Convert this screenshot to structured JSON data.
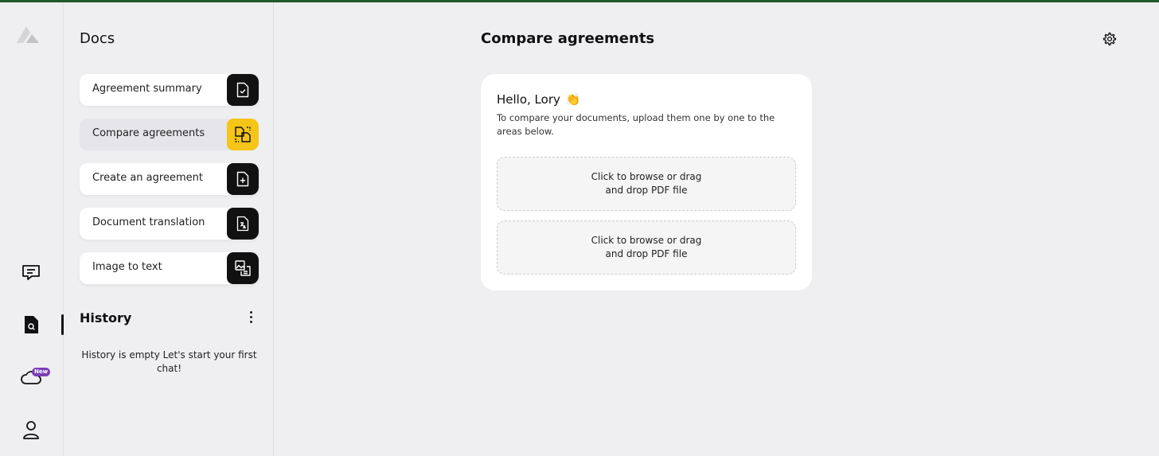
{
  "rail": {
    "items": [
      {
        "name": "chat",
        "icon": "chat-bubble-icon"
      },
      {
        "name": "docs",
        "icon": "document-search-icon"
      },
      {
        "name": "cloud",
        "icon": "cloud-icon",
        "badge": "New"
      },
      {
        "name": "profile",
        "icon": "user-icon"
      }
    ],
    "active": "docs"
  },
  "docs": {
    "title": "Docs",
    "items": [
      {
        "label": "Agreement summary",
        "icon": "document-check-icon"
      },
      {
        "label": "Compare agreements",
        "icon": "document-compare-icon",
        "active": true
      },
      {
        "label": "Create an agreement",
        "icon": "document-plus-icon"
      },
      {
        "label": "Document translation",
        "icon": "document-translate-icon"
      },
      {
        "label": "Image to text",
        "icon": "image-text-icon"
      }
    ]
  },
  "history": {
    "title": "History",
    "empty_text": "History is empty Let's start your first chat!"
  },
  "main": {
    "title": "Compare agreements",
    "card": {
      "greeting": "Hello, Lory",
      "greeting_emoji": "👏",
      "instructions": "To compare your documents, upload them one by one to the areas below.",
      "drop_zones": [
        {
          "line1": "Click to browse or drag",
          "line2": "and drop PDF file"
        },
        {
          "line1": "Click to browse or drag",
          "line2": "and drop PDF file"
        }
      ]
    }
  },
  "colors": {
    "accent_top": "#1f5a2b",
    "active_icon_bg": "#f5c518",
    "icon_bg": "#111111",
    "badge": "#7b3fb8"
  }
}
